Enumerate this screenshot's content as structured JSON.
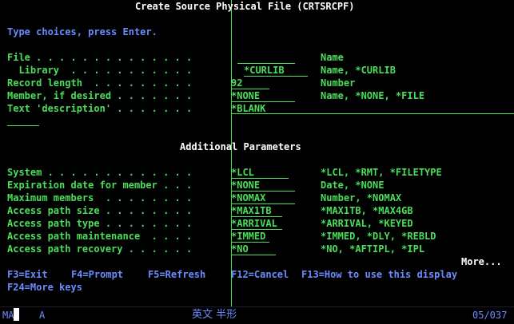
{
  "title": "Create Source Physical File (CRTSRCPF)",
  "instructions": "Type choices, press Enter.",
  "fields": [
    {
      "label": "File . . . . . . . . . . . . . .",
      "value": "",
      "hint": "Name"
    },
    {
      "label": "  Library  . . . . . . . . . . .",
      "value": "*CURLIB",
      "hint": "Name, *CURLIB"
    },
    {
      "label": "Record length  . . . . . . . . .",
      "value": "92",
      "hint": "Number"
    },
    {
      "label": "Member, if desired . . . . . . .",
      "value": "*NONE",
      "hint": "Name, *NONE, *FILE"
    },
    {
      "label": "Text 'description' . . . . . . .",
      "value": "*BLANK",
      "hint": ""
    }
  ],
  "section_title": "Additional Parameters",
  "additional_fields": [
    {
      "label": "System . . . . . . . . . . . . .",
      "value": "*LCL",
      "hint": "*LCL, *RMT, *FILETYPE"
    },
    {
      "label": "Expiration date for member . . .",
      "value": "*NONE",
      "hint": "Date, *NONE"
    },
    {
      "label": "Maximum members  . . . . . . . .",
      "value": "*NOMAX",
      "hint": "Number, *NOMAX"
    },
    {
      "label": "Access path size . . . . . . . .",
      "value": "*MAX1TB",
      "hint": "*MAX1TB, *MAX4GB"
    },
    {
      "label": "Access path type . . . . . . . .",
      "value": "*ARRIVAL",
      "hint": "*ARRIVAL, *KEYED"
    },
    {
      "label": "Access path maintenance  . . . .",
      "value": "*IMMED",
      "hint": "*IMMED, *DLY, *REBLD"
    },
    {
      "label": "Access path recovery . . . . . .",
      "value": "*NO",
      "hint": "*NO, *AFTIPL, *IPL"
    }
  ],
  "more_indicator": "More...",
  "function_keys": {
    "f3": "F3=Exit",
    "f4": "F4=Prompt",
    "f5": "F5=Refresh",
    "f12": "F12=Cancel",
    "f13": "F13=How to use this display",
    "f24": "F24=More keys"
  },
  "status_bar": {
    "indicator": "MA",
    "mode": "A",
    "input_mode": "英文 半形",
    "cursor_position": "05/037"
  },
  "colors": {
    "background": "#000000",
    "text_green": "#4ade5a",
    "text_white": "#ffffff",
    "text_blue": "#6b8bff"
  }
}
